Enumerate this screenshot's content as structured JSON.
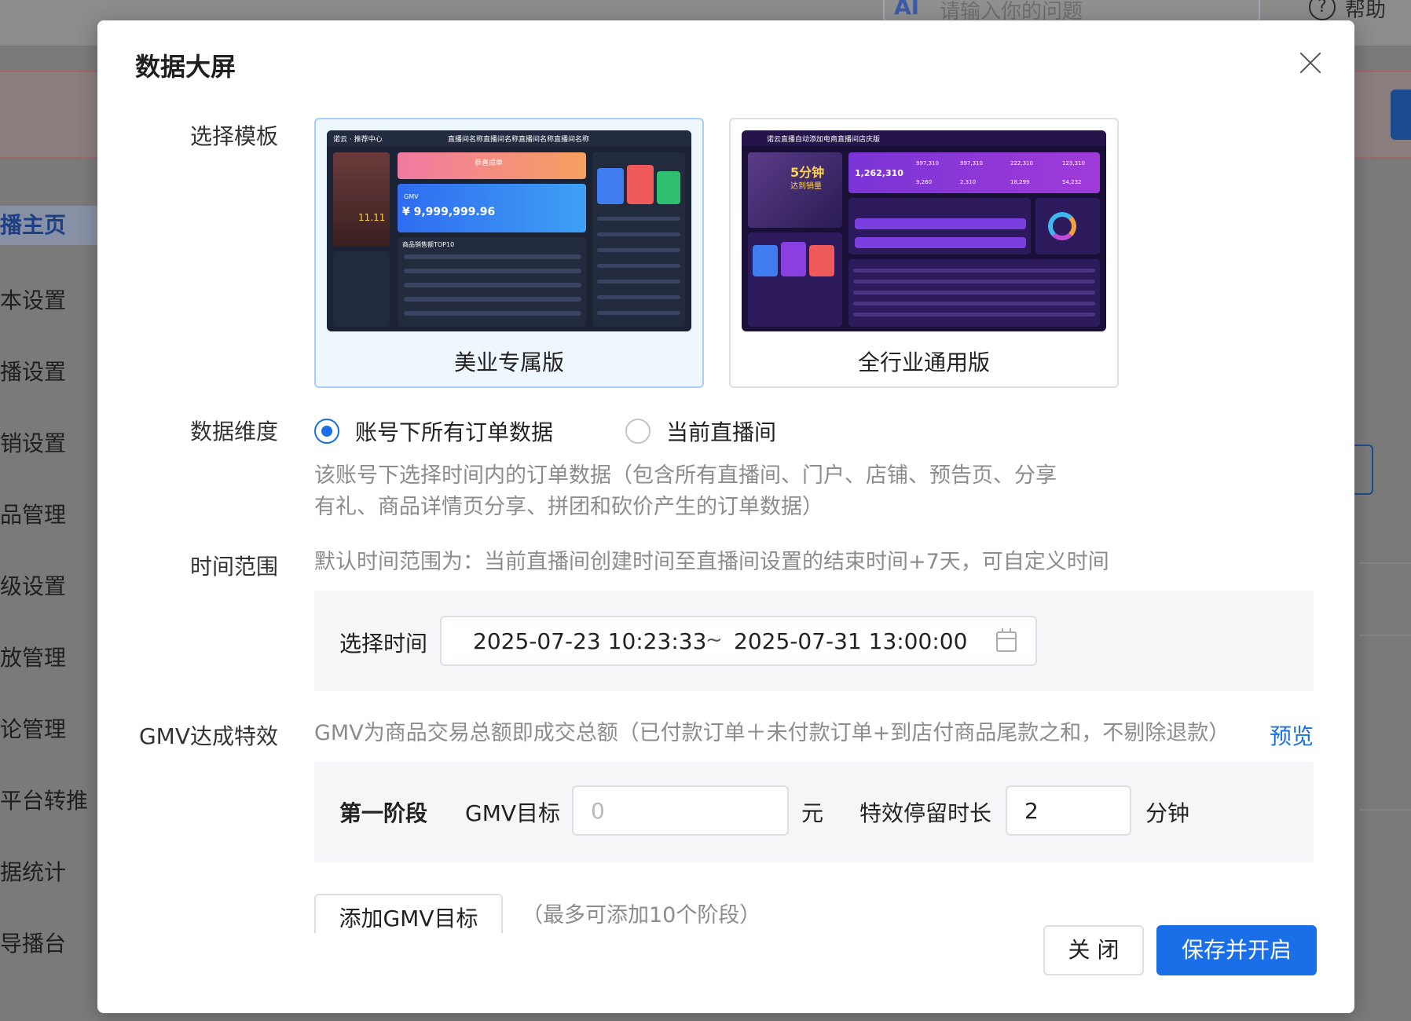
{
  "background": {
    "search_placeholder": "请输入你的问题",
    "search_badge": "AI",
    "help_label": "帮助",
    "sidebar": [
      "播主页",
      "本设置",
      "播设置",
      "销设置",
      "品管理",
      "级设置",
      "放管理",
      "论管理",
      "平台转推",
      "据统计",
      "导播台"
    ]
  },
  "modal": {
    "title": "数据大屏",
    "template_label": "选择模板",
    "templates": [
      {
        "name": "美业专属版",
        "selected": true
      },
      {
        "name": "全行业通用版",
        "selected": false
      }
    ],
    "thumb1": {
      "header": "直播间名称直播间名称直播间名称直播间名称",
      "brand": "诺云 · 推荐中心",
      "gmv_label": "GMV",
      "gmv_value": "¥ 9,999,999.96",
      "top_label": "商品销售额TOP10",
      "badge": "恭喜成单",
      "live_label": "11.11"
    },
    "thumb2": {
      "header": "诺云直播自动添加电商直播间店庆版",
      "promo": "5分钟",
      "promo2": "达到销量",
      "big_number": "1,262,310",
      "stats": [
        "997,310",
        "997,310",
        "222,310",
        "123,310"
      ],
      "stats2": [
        "9,260",
        "2,310",
        "18,299",
        "54,232"
      ]
    },
    "dimension": {
      "label": "数据维度",
      "options": [
        {
          "label": "账号下所有订单数据",
          "checked": true
        },
        {
          "label": "当前直播间",
          "checked": false
        }
      ],
      "hint_line1": "该账号下选择时间内的订单数据（包含所有直播间、门户、店铺、预告页、分享",
      "hint_line2": "有礼、商品详情页分享、拼团和砍价产生的订单数据）"
    },
    "time": {
      "label": "时间范围",
      "hint": "默认时间范围为：当前直播间创建时间至直播间设置的结束时间+7天，可自定义时间",
      "picker_label": "选择时间",
      "start": "2025-07-23 10:23:33",
      "separator": "~",
      "end": "2025-07-31 13:00:00"
    },
    "gmv": {
      "label": "GMV达成特效",
      "hint": "GMV为商品交易总额即成交总额（已付款订单＋未付款订单+到店付商品尾款之和，不剔除退款）",
      "preview": "预览",
      "stage_label": "第一阶段",
      "target_label": "GMV目标",
      "target_placeholder": "0",
      "target_unit": "元",
      "duration_label": "特效停留时长",
      "duration_value": "2",
      "duration_unit": "分钟",
      "add_button": "添加GMV目标",
      "add_hint": "（最多可添加10个阶段）"
    },
    "footer": {
      "close": "关 闭",
      "save": "保存并开启"
    }
  }
}
